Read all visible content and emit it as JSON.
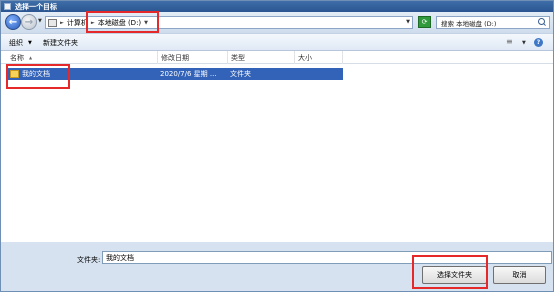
{
  "window": {
    "title": "选择一个目标"
  },
  "address_bar": {
    "segments": [
      "计算机",
      "本地磁盘 (D:)"
    ]
  },
  "search": {
    "placeholder": "搜索 本地磁盘 (D:)"
  },
  "toolbar": {
    "organize": "组织",
    "new_folder": "新建文件夹"
  },
  "columns": {
    "name": "名称",
    "date": "修改日期",
    "type": "类型",
    "size": "大小"
  },
  "files": [
    {
      "name": "我的文档",
      "date": "2020/7/6 星期 ...",
      "type": "文件夹",
      "size": "",
      "selected": true
    }
  ],
  "bottom": {
    "folder_label": "文件夹:",
    "folder_value": "我的文档",
    "select_button": "选择文件夹",
    "cancel_button": "取消"
  },
  "colors": {
    "selection": "#3363b8",
    "annotation": "#e5282a"
  }
}
